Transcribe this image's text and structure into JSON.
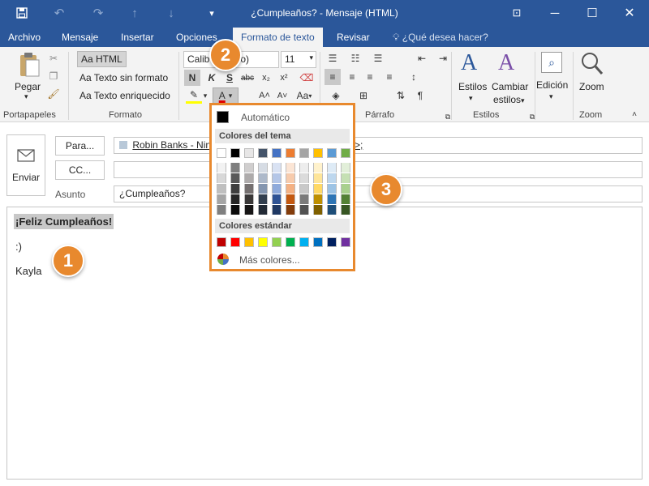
{
  "window": {
    "title": "¿Cumpleaños? - Mensaje (HTML)"
  },
  "tabs": [
    {
      "label": "Archivo"
    },
    {
      "label": "Mensaje"
    },
    {
      "label": "Insertar"
    },
    {
      "label": "Opciones"
    },
    {
      "label": "Formato de texto",
      "active": true
    },
    {
      "label": "Revisar"
    }
  ],
  "tell_me": "¿Qué desea hacer?",
  "ribbon": {
    "portapapeles": {
      "paste": "Pegar",
      "group": "Portapapeles"
    },
    "formato": {
      "html": "HTML",
      "plain": "Texto sin formato",
      "rich": "Texto enriquecido",
      "group": "Formato"
    },
    "fuente": {
      "font_left": "Calib",
      "font_right": "po)",
      "size": "11"
    },
    "parrafo": {
      "group": "Párrafo"
    },
    "estilos": {
      "styles": "Estilos",
      "change1": "Cambiar",
      "change2": "estilos",
      "group": "Estilos"
    },
    "edicion": {
      "label": "Edición"
    },
    "zoom": {
      "label": "Zoom",
      "group": "Zoom"
    }
  },
  "header": {
    "send": "Enviar",
    "to_button": "Para...",
    "cc_button": "CC...",
    "subject_label": "Asunto",
    "to_value_left": "Robin Banks - Ninco",
    "to_value_right": ">;",
    "subject_value": "¿Cumpleaños?"
  },
  "message_body": {
    "line1": "¡Feliz Cumpleaños!",
    "line2": ":)",
    "line3": "Kayla"
  },
  "color_picker": {
    "automatic": "Automático",
    "theme_header": "Colores del tema",
    "standard_header": "Colores estándar",
    "more_colors": "Más colores...",
    "theme_colors": [
      "#ffffff",
      "#000000",
      "#e7e6e6",
      "#44546a",
      "#4472c4",
      "#ed7d31",
      "#a5a5a5",
      "#ffc000",
      "#5b9bd5",
      "#70ad47"
    ],
    "theme_shades": [
      [
        "#f2f2f2",
        "#7f7f7f",
        "#d0cece",
        "#d6dce4",
        "#d9e2f3",
        "#fbe5d5",
        "#ededed",
        "#fff2cc",
        "#deebf6",
        "#e2efd9"
      ],
      [
        "#d8d8d8",
        "#595959",
        "#aeabab",
        "#adb9ca",
        "#b4c6e7",
        "#f7cbac",
        "#dbdbdb",
        "#fee599",
        "#bdd7ee",
        "#c5e0b3"
      ],
      [
        "#bfbfbf",
        "#3f3f3f",
        "#757070",
        "#8496b0",
        "#8eaadb",
        "#f4b183",
        "#c9c9c9",
        "#ffd965",
        "#9cc3e5",
        "#a8d08d"
      ],
      [
        "#a5a5a5",
        "#262626",
        "#3a3838",
        "#323f4f",
        "#2e5395",
        "#c45911",
        "#7b7b7b",
        "#bf9000",
        "#2e75b5",
        "#538135"
      ],
      [
        "#7f7f7f",
        "#0c0c0c",
        "#171616",
        "#222a35",
        "#1f3863",
        "#833c0b",
        "#525252",
        "#7f6000",
        "#1e4e79",
        "#375623"
      ]
    ],
    "standard_colors": [
      "#c00000",
      "#ff0000",
      "#ffc000",
      "#ffff00",
      "#92d050",
      "#00b050",
      "#00b0f0",
      "#0070c0",
      "#002060",
      "#7030a0"
    ]
  },
  "callouts": [
    "1",
    "2",
    "3"
  ]
}
